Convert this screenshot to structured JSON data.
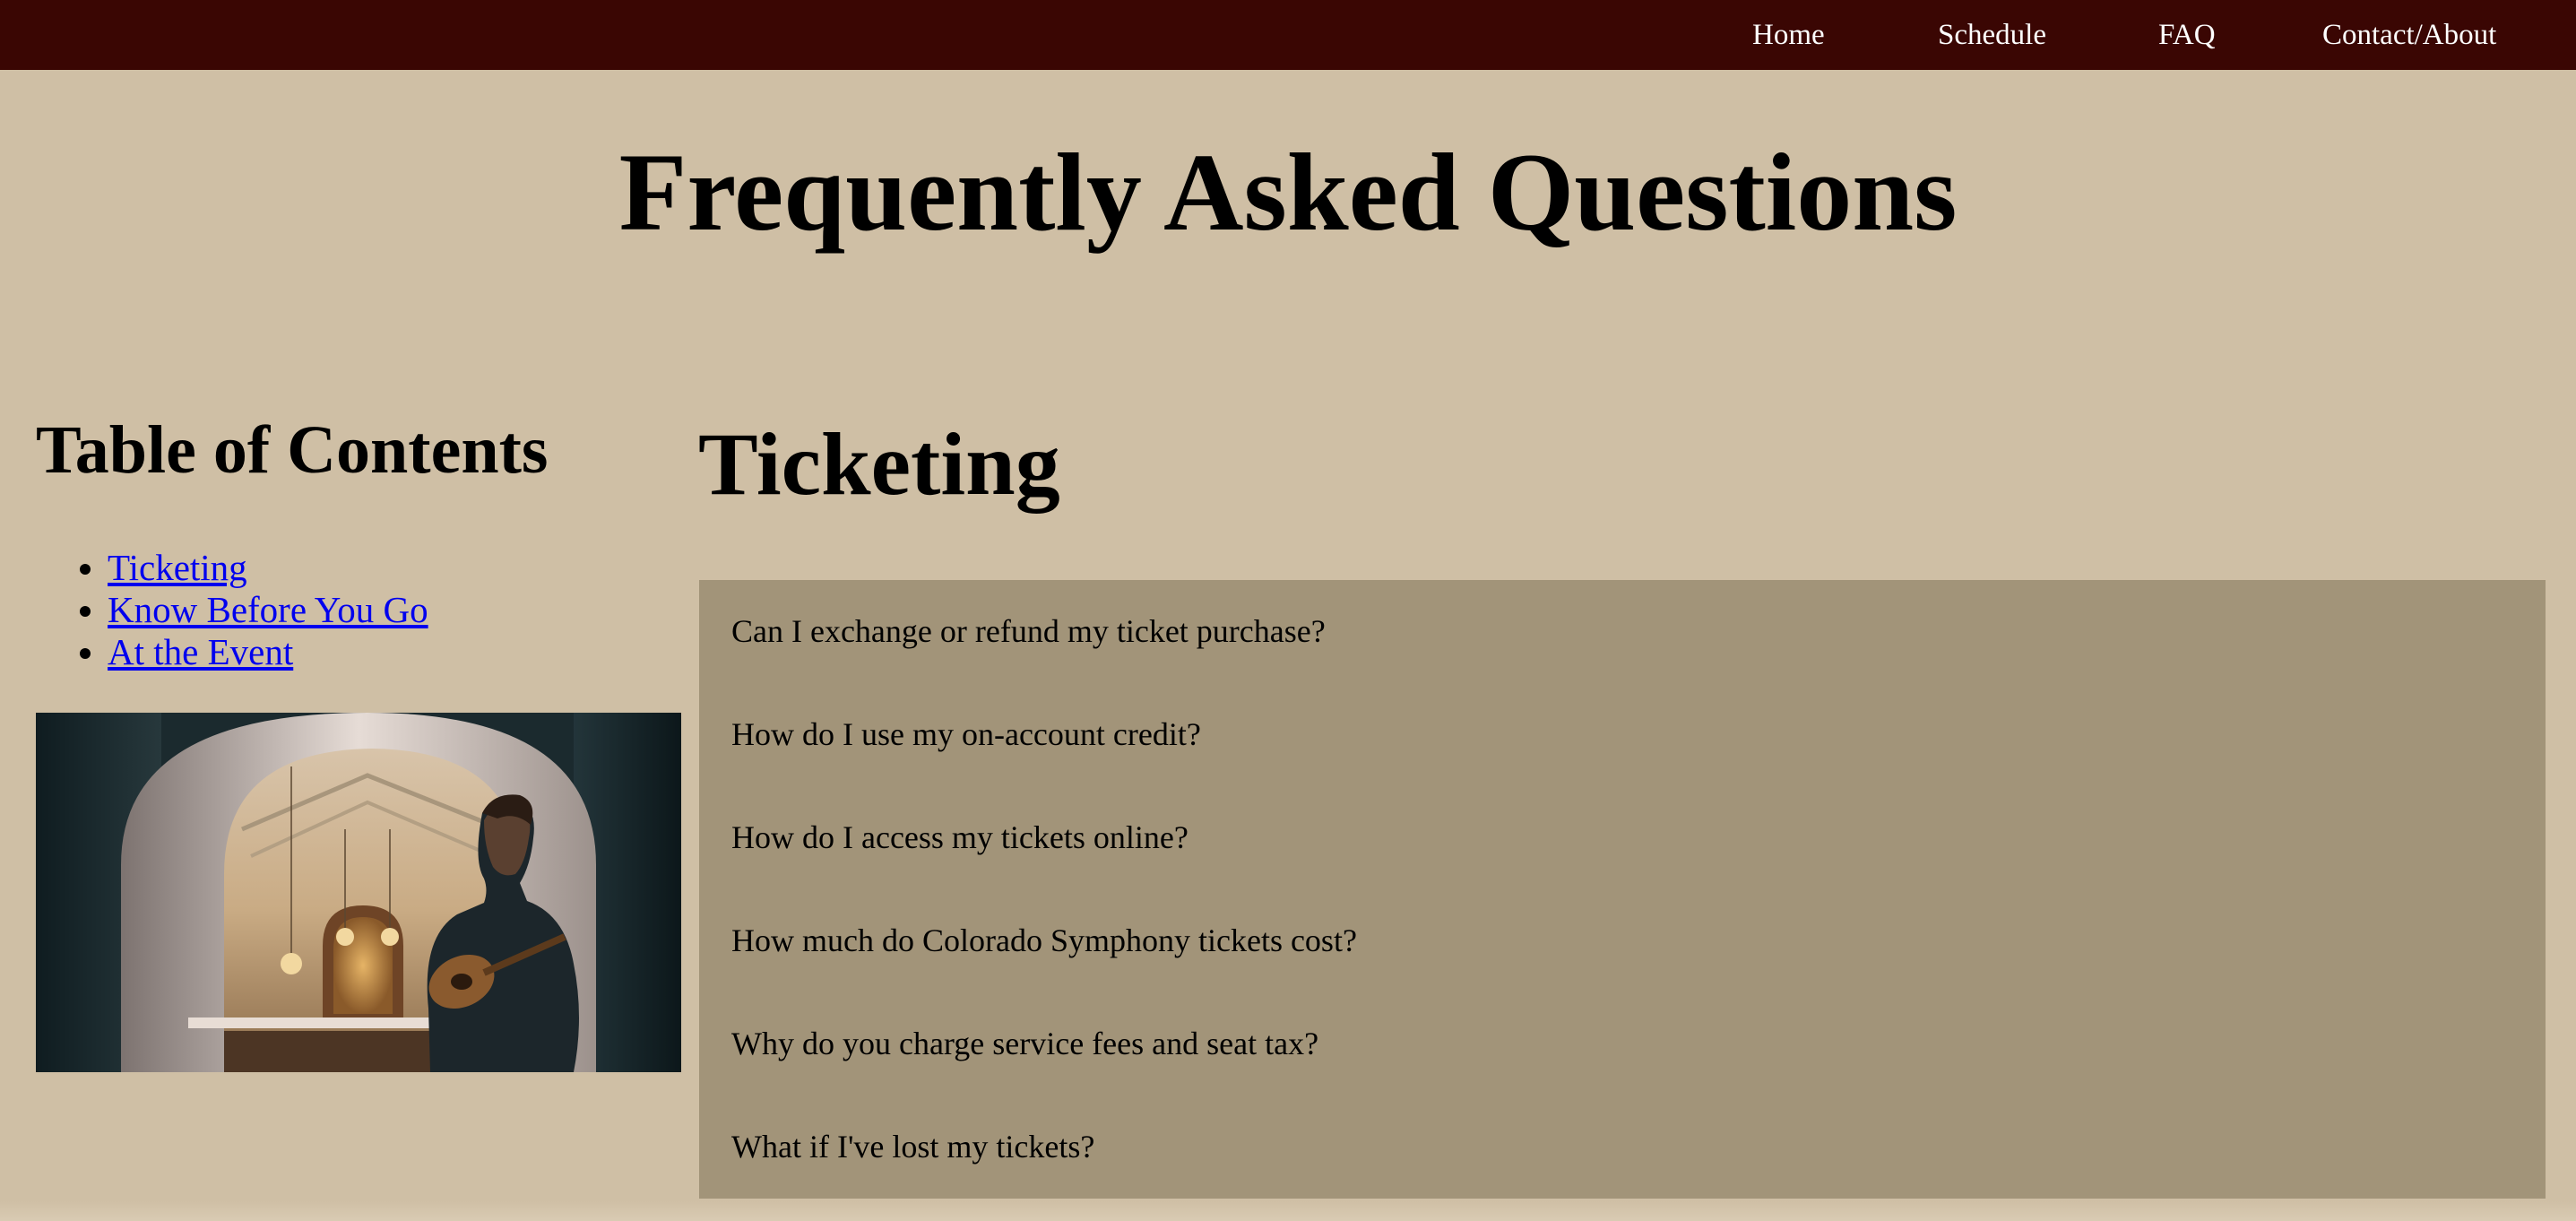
{
  "nav": {
    "items": [
      {
        "label": "Home"
      },
      {
        "label": "Schedule"
      },
      {
        "label": "FAQ"
      },
      {
        "label": "Contact/About"
      }
    ]
  },
  "page": {
    "title": "Frequently Asked Questions"
  },
  "toc": {
    "heading": "Table of Contents",
    "items": [
      {
        "label": "Ticketing"
      },
      {
        "label": "Know Before You Go"
      },
      {
        "label": "At the Event"
      }
    ]
  },
  "section": {
    "heading": "Ticketing",
    "questions": [
      {
        "text": "Can I exchange or refund my ticket purchase?"
      },
      {
        "text": "How do I use my on-account credit?"
      },
      {
        "text": "How do I access my tickets online?"
      },
      {
        "text": "How much do Colorado Symphony tickets cost?"
      },
      {
        "text": "Why do you charge service fees and seat tax?"
      },
      {
        "text": "What if I've lost my tickets?"
      }
    ]
  },
  "colors": {
    "nav_bg": "#3a0603",
    "page_bg": "#cfbfa5",
    "faq_bg": "#a29479",
    "link": "#0000ee"
  }
}
